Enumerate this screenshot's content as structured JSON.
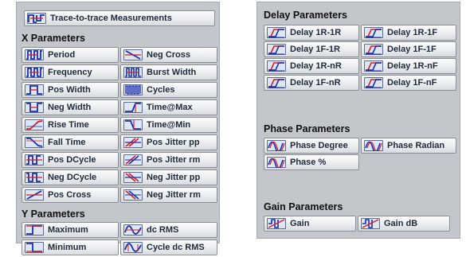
{
  "left": {
    "trace_button": {
      "label": "Trace-to-trace Measurements",
      "icon": "trace-to-trace-icon"
    },
    "x_section": {
      "title": "X Parameters",
      "buttons": [
        {
          "label": "Period",
          "icon": "period-icon"
        },
        {
          "label": "Neg Cross",
          "icon": "neg-cross-icon"
        },
        {
          "label": "Frequency",
          "icon": "frequency-icon"
        },
        {
          "label": "Burst Width",
          "icon": "burst-width-icon"
        },
        {
          "label": "Pos Width",
          "icon": "pos-width-icon"
        },
        {
          "label": "Cycles",
          "icon": "cycles-icon"
        },
        {
          "label": "Neg Width",
          "icon": "neg-width-icon"
        },
        {
          "label": "Time@Max",
          "icon": "time-at-max-icon"
        },
        {
          "label": "Rise Time",
          "icon": "rise-time-icon"
        },
        {
          "label": "Time@Min",
          "icon": "time-at-min-icon"
        },
        {
          "label": "Fall Time",
          "icon": "fall-time-icon"
        },
        {
          "label": "Pos Jitter pp",
          "icon": "pos-jitter-pp-icon"
        },
        {
          "label": "Pos DCycle",
          "icon": "pos-dcycle-icon"
        },
        {
          "label": "Pos Jitter rm",
          "icon": "pos-jitter-rms-icon"
        },
        {
          "label": "Neg DCycle",
          "icon": "neg-dcycle-icon"
        },
        {
          "label": "Neg Jitter pp",
          "icon": "neg-jitter-pp-icon"
        },
        {
          "label": "Pos Cross",
          "icon": "pos-cross-icon"
        },
        {
          "label": "Neg Jitter rm",
          "icon": "neg-jitter-rms-icon"
        }
      ]
    },
    "y_section": {
      "title": "Y Parameters",
      "buttons": [
        {
          "label": "Maximum",
          "icon": "maximum-icon"
        },
        {
          "label": "dc RMS",
          "icon": "dc-rms-icon"
        },
        {
          "label": "Minimum",
          "icon": "minimum-icon"
        },
        {
          "label": "Cycle dc RMS",
          "icon": "cycle-dc-rms-icon"
        }
      ]
    }
  },
  "right": {
    "delay_section": {
      "title": "Delay Parameters",
      "buttons": [
        {
          "label": "Delay 1R-1R",
          "icon": "delay-icon"
        },
        {
          "label": "Delay 1R-1F",
          "icon": "delay-icon"
        },
        {
          "label": "Delay 1F-1R",
          "icon": "delay-icon"
        },
        {
          "label": "Delay 1F-1F",
          "icon": "delay-icon"
        },
        {
          "label": "Delay 1R-nR",
          "icon": "delay-icon"
        },
        {
          "label": "Delay 1R-nF",
          "icon": "delay-icon"
        },
        {
          "label": "Delay 1F-nR",
          "icon": "delay-icon"
        },
        {
          "label": "Delay 1F-nF",
          "icon": "delay-icon"
        }
      ]
    },
    "phase_section": {
      "title": "Phase Parameters",
      "buttons": [
        {
          "label": "Phase Degree",
          "icon": "phase-icon"
        },
        {
          "label": "Phase Radian",
          "icon": "phase-icon"
        },
        {
          "label": "Phase %",
          "icon": "phase-icon"
        }
      ]
    },
    "gain_section": {
      "title": "Gain Parameters",
      "buttons": [
        {
          "label": "Gain",
          "icon": "gain-icon"
        },
        {
          "label": "Gain dB",
          "icon": "gain-icon"
        }
      ]
    }
  },
  "colors": {
    "panel_bg": "#c3c6cb",
    "icon_blue": "#1a2fb0",
    "icon_red": "#d42020",
    "label_text": "#1f2a3a"
  }
}
